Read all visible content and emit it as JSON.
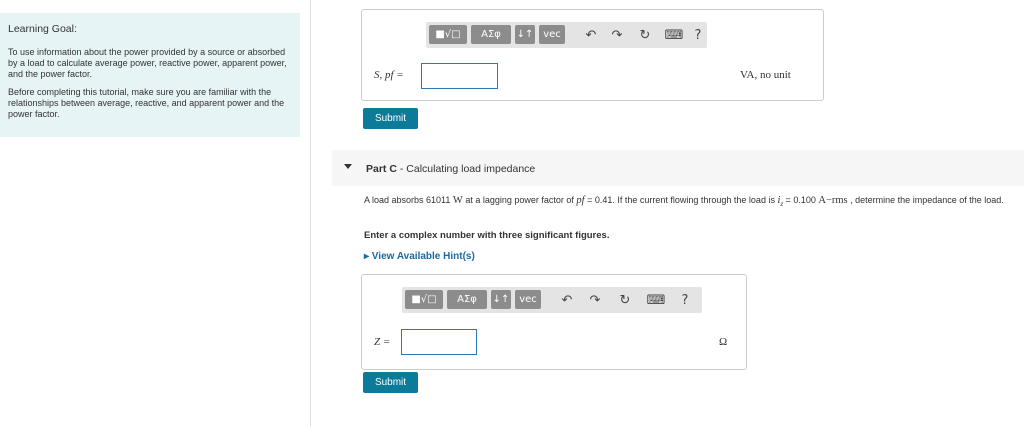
{
  "goal": {
    "heading": "Learning Goal:",
    "para1": "To use information about the power provided by a source or absorbed by a load to calculate average power, reactive power, apparent power, and the power factor.",
    "para2": "Before completing this tutorial, make sure you are familiar with the relationships between average, reactive, and apparent power and the power factor."
  },
  "toolbar": {
    "templates_label": "■√□",
    "greek_label": "ΑΣφ",
    "arrows_label": "↓↑",
    "vec_label": "vec",
    "undo_icon": "↶",
    "redo_icon": "↷",
    "reset_icon": "↻",
    "keyboard_icon": "⌨",
    "help_label": "?"
  },
  "partB": {
    "var_label": "S, pf =",
    "input_value": "",
    "unit": "VA, no unit",
    "submit_label": "Submit"
  },
  "partC": {
    "part_prefix": "Part C",
    "part_title": " - Calculating load impedance",
    "problem_text_1": "A load absorbs 61011 ",
    "unit_W": "W",
    "problem_text_2": " at a lagging power factor of ",
    "pf_symbol": "pf",
    "problem_text_3": " = 0.41. If the current flowing through the load is ",
    "i_symbol": "i",
    "i_sub": "z",
    "problem_text_4": " = 0.100 ",
    "unit_Arms": "A−rms",
    "problem_text_5": " , determine the impedance of the load.",
    "instruction": "Enter a complex number with three significant figures.",
    "hint_link": "▸ View Available Hint(s)",
    "var_label": "Z =",
    "input_value": "",
    "unit": "Ω",
    "submit_label": "Submit"
  }
}
